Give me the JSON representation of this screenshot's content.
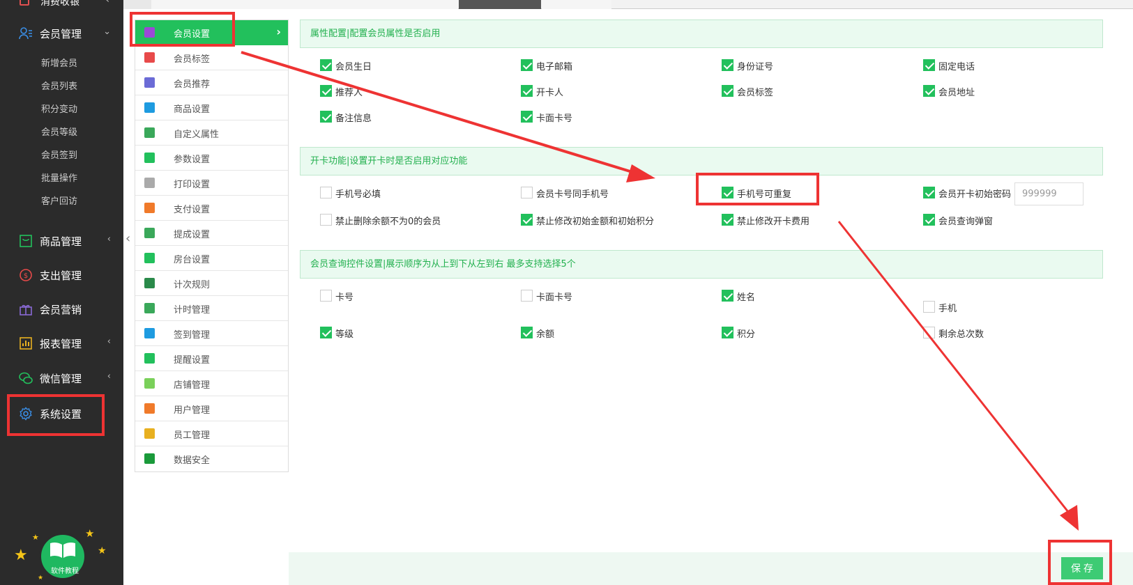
{
  "nav": {
    "top_label": "消费收银",
    "groups": [
      {
        "label": "会员管理",
        "arrow": "⌄"
      },
      {
        "label": "商品管理",
        "arrow": "‹"
      },
      {
        "label": "支出管理",
        "arrow": ""
      },
      {
        "label": "会员营销",
        "arrow": ""
      },
      {
        "label": "报表管理",
        "arrow": "‹"
      },
      {
        "label": "微信管理",
        "arrow": "‹"
      },
      {
        "label": "系统设置",
        "arrow": ""
      }
    ],
    "member_sub": [
      "新增会员",
      "会员列表",
      "积分变动",
      "会员等级",
      "会员签到",
      "批量操作",
      "客户回访"
    ],
    "help_label": "软件教程"
  },
  "submenu": [
    {
      "label": "会员设置",
      "color": "#22c05c"
    },
    {
      "label": "会员标签",
      "color": "#e84a4a"
    },
    {
      "label": "会员推荐",
      "color": "#6b6bd6"
    },
    {
      "label": "商品设置",
      "color": "#1e9be0"
    },
    {
      "label": "自定义属性",
      "color": "#3aa85a"
    },
    {
      "label": "参数设置",
      "color": "#22c05c"
    },
    {
      "label": "打印设置",
      "color": "#aaaaaa"
    },
    {
      "label": "支付设置",
      "color": "#f07a2a"
    },
    {
      "label": "提成设置",
      "color": "#3aa85a"
    },
    {
      "label": "房台设置",
      "color": "#22c05c"
    },
    {
      "label": "计次规则",
      "color": "#2a8a4a"
    },
    {
      "label": "计时管理",
      "color": "#3aa85a"
    },
    {
      "label": "签到管理",
      "color": "#1e9be0"
    },
    {
      "label": "提醒设置",
      "color": "#22c05c"
    },
    {
      "label": "店铺管理",
      "color": "#7ad05a"
    },
    {
      "label": "用户管理",
      "color": "#f07a2a"
    },
    {
      "label": "员工管理",
      "color": "#e8b020"
    },
    {
      "label": "数据安全",
      "color": "#1a9a3a"
    }
  ],
  "sections": {
    "attr_title": "属性配置|配置会员属性是否启用",
    "card_title": "开卡功能|设置开卡时是否启用对应功能",
    "query_title": "会员查询控件设置|展示顺序为从上到下从左到右 最多支持选择5个"
  },
  "attr_options": [
    {
      "label": "会员生日",
      "checked": true
    },
    {
      "label": "电子邮箱",
      "checked": true
    },
    {
      "label": "身份证号",
      "checked": true
    },
    {
      "label": "固定电话",
      "checked": true
    },
    {
      "label": "推荐人",
      "checked": true
    },
    {
      "label": "开卡人",
      "checked": true
    },
    {
      "label": "会员标签",
      "checked": true
    },
    {
      "label": "会员地址",
      "checked": true
    },
    {
      "label": "备注信息",
      "checked": true
    },
    {
      "label": "卡面卡号",
      "checked": true
    }
  ],
  "card_options": [
    {
      "label": "手机号必填",
      "checked": false
    },
    {
      "label": "会员卡号同手机号",
      "checked": false
    },
    {
      "label": "手机号可重复",
      "checked": true
    },
    {
      "label": "会员开卡初始密码",
      "checked": true
    },
    {
      "label": "禁止删除余额不为0的会员",
      "checked": false
    },
    {
      "label": "禁止修改初始金额和初始积分",
      "checked": true
    },
    {
      "label": "禁止修改开卡费用",
      "checked": true
    },
    {
      "label": "会员查询弹窗",
      "checked": true
    }
  ],
  "initial_password": "999999",
  "query_options": [
    {
      "label": "卡号",
      "checked": false
    },
    {
      "label": "卡面卡号",
      "checked": false
    },
    {
      "label": "姓名",
      "checked": true
    },
    {
      "label": "手机",
      "checked": false
    },
    {
      "label": "等级",
      "checked": true
    },
    {
      "label": "余额",
      "checked": true
    },
    {
      "label": "积分",
      "checked": true
    },
    {
      "label": "剩余总次数",
      "checked": false
    }
  ],
  "save_label": "保 存"
}
